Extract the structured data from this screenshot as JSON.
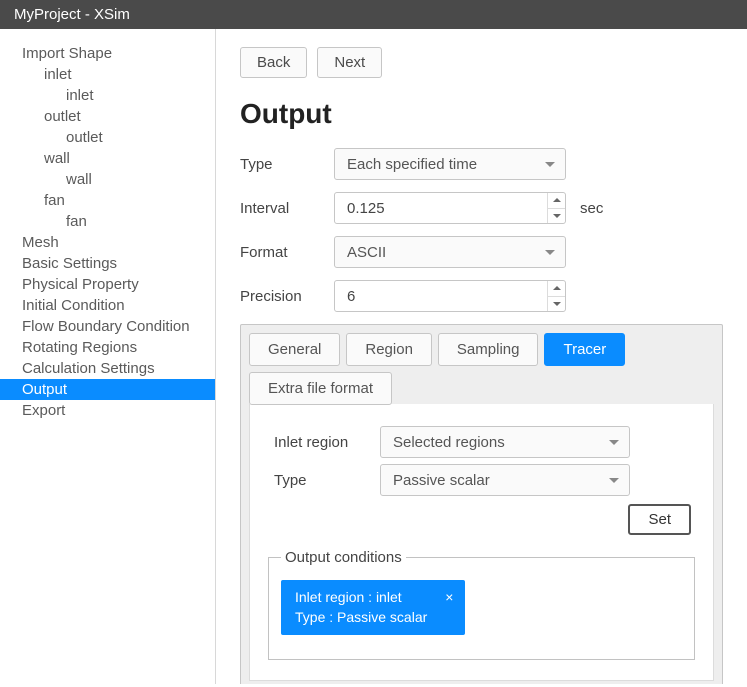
{
  "window": {
    "title": "MyProject - XSim"
  },
  "sidebar": {
    "items": [
      {
        "label": "Import Shape",
        "level": 0
      },
      {
        "label": "inlet",
        "level": 1
      },
      {
        "label": "inlet",
        "level": 2
      },
      {
        "label": "outlet",
        "level": 1
      },
      {
        "label": "outlet",
        "level": 2
      },
      {
        "label": "wall",
        "level": 1
      },
      {
        "label": "wall",
        "level": 2
      },
      {
        "label": "fan",
        "level": 1
      },
      {
        "label": "fan",
        "level": 2
      },
      {
        "label": "Mesh",
        "level": 0
      },
      {
        "label": "Basic Settings",
        "level": 0
      },
      {
        "label": "Physical Property",
        "level": 0
      },
      {
        "label": "Initial Condition",
        "level": 0
      },
      {
        "label": "Flow Boundary Condition",
        "level": 0
      },
      {
        "label": "Rotating Regions",
        "level": 0
      },
      {
        "label": "Calculation Settings",
        "level": 0
      },
      {
        "label": "Output",
        "level": 0,
        "selected": true
      },
      {
        "label": "Export",
        "level": 0
      }
    ]
  },
  "nav": {
    "back": "Back",
    "next": "Next"
  },
  "page": {
    "title": "Output"
  },
  "fields": {
    "type": {
      "label": "Type",
      "value": "Each specified time"
    },
    "interval": {
      "label": "Interval",
      "value": "0.125",
      "unit": "sec"
    },
    "format": {
      "label": "Format",
      "value": "ASCII"
    },
    "precision": {
      "label": "Precision",
      "value": "6"
    }
  },
  "tabs": {
    "items": [
      "General",
      "Region",
      "Sampling",
      "Tracer",
      "Extra file format"
    ],
    "active": "Tracer"
  },
  "tracer": {
    "inlet_region": {
      "label": "Inlet region",
      "value": "Selected regions"
    },
    "type": {
      "label": "Type",
      "value": "Passive scalar"
    },
    "set_button": "Set",
    "conditions_legend": "Output conditions",
    "chip": {
      "line1": "Inlet region : inlet",
      "line2": "Type : Passive scalar",
      "close": "×"
    }
  }
}
